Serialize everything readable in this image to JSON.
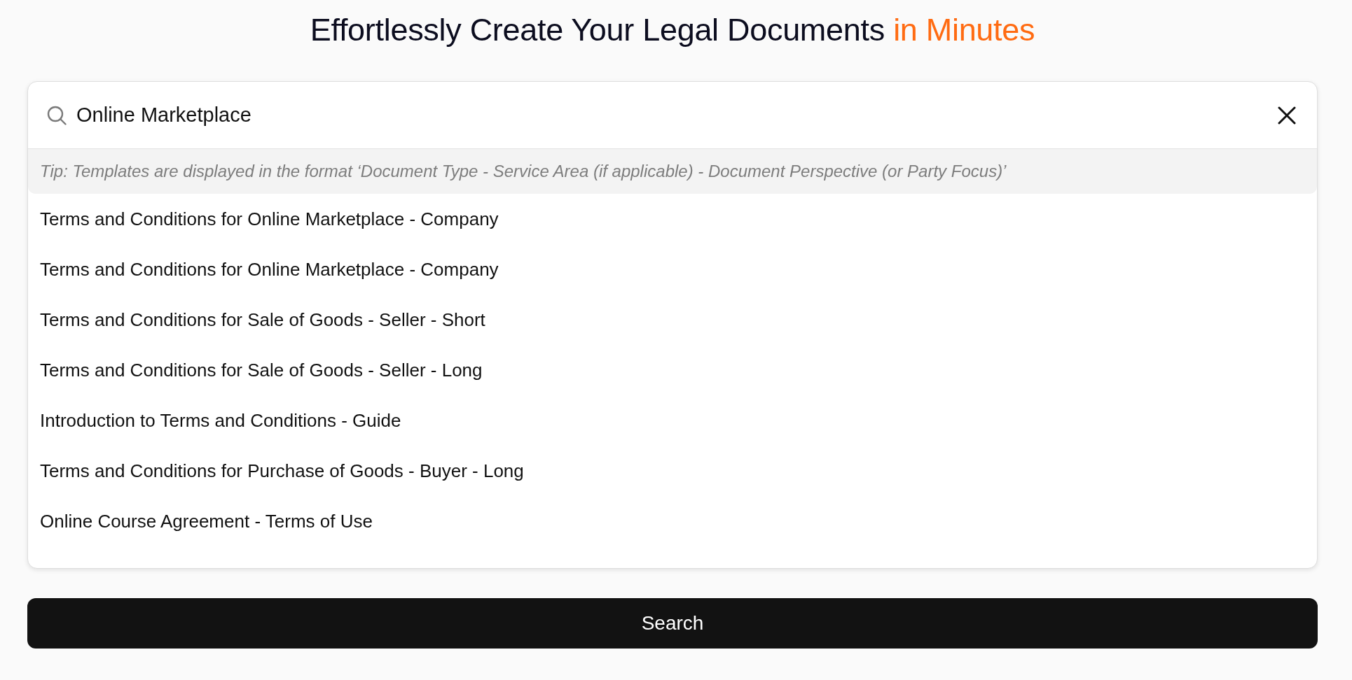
{
  "title": {
    "text": "Effortlessly Create Your Legal Documents",
    "highlight": "in Minutes"
  },
  "search": {
    "value": "Online Marketplace"
  },
  "tip": "Tip: Templates are displayed in the format ‘Document Type - Service Area (if applicable) - Document Perspective (or Party Focus)’",
  "results": [
    "Terms and Conditions for Online Marketplace - Company",
    "Terms and Conditions for Online Marketplace - Company",
    "Terms and Conditions for Sale of Goods - Seller - Short",
    "Terms and Conditions for Sale of Goods - Seller - Long",
    "Introduction to Terms and Conditions - Guide",
    "Terms and Conditions for Purchase of Goods - Buyer - Long",
    "Online Course Agreement - Terms of Use"
  ],
  "button": "Search"
}
